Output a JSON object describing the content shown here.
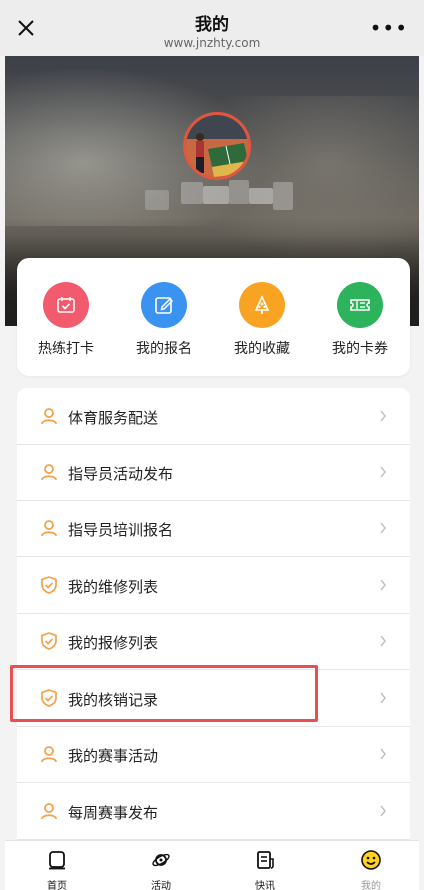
{
  "topbar": {
    "title": "我的",
    "url": "www.jnzhty.com",
    "more": "•••"
  },
  "colors": {
    "accent_orange": "#f5a24a",
    "highlight_red": "#e84e52",
    "qa_pink": "#f25a6e",
    "qa_blue": "#3a93f0",
    "qa_orange": "#f8a321",
    "qa_green": "#2db35b"
  },
  "quick_actions": [
    {
      "label": "热练打卡",
      "icon": "calendar-check-icon",
      "color": "#f25a6e"
    },
    {
      "label": "我的报名",
      "icon": "edit-icon",
      "color": "#3a93f0"
    },
    {
      "label": "我的收藏",
      "icon": "tree-icon",
      "color": "#f8a321"
    },
    {
      "label": "我的卡券",
      "icon": "ticket-icon",
      "color": "#2db35b"
    }
  ],
  "menu": [
    {
      "label": "体育服务配送",
      "icon": "user-icon"
    },
    {
      "label": "指导员活动发布",
      "icon": "user-icon"
    },
    {
      "label": "指导员培训报名",
      "icon": "user-icon"
    },
    {
      "label": "我的维修列表",
      "icon": "shield-check-icon"
    },
    {
      "label": "我的报修列表",
      "icon": "shield-check-icon"
    },
    {
      "label": "我的核销记录",
      "icon": "shield-check-icon"
    },
    {
      "label": "我的赛事活动",
      "icon": "user-icon"
    },
    {
      "label": "每周赛事发布",
      "icon": "user-icon"
    }
  ],
  "bottom_nav": [
    {
      "label": "首页",
      "icon": "home-icon"
    },
    {
      "label": "活动",
      "icon": "activity-icon"
    },
    {
      "label": "快讯",
      "icon": "news-icon"
    },
    {
      "label": "我的",
      "icon": "smiley-icon",
      "active": true
    }
  ]
}
